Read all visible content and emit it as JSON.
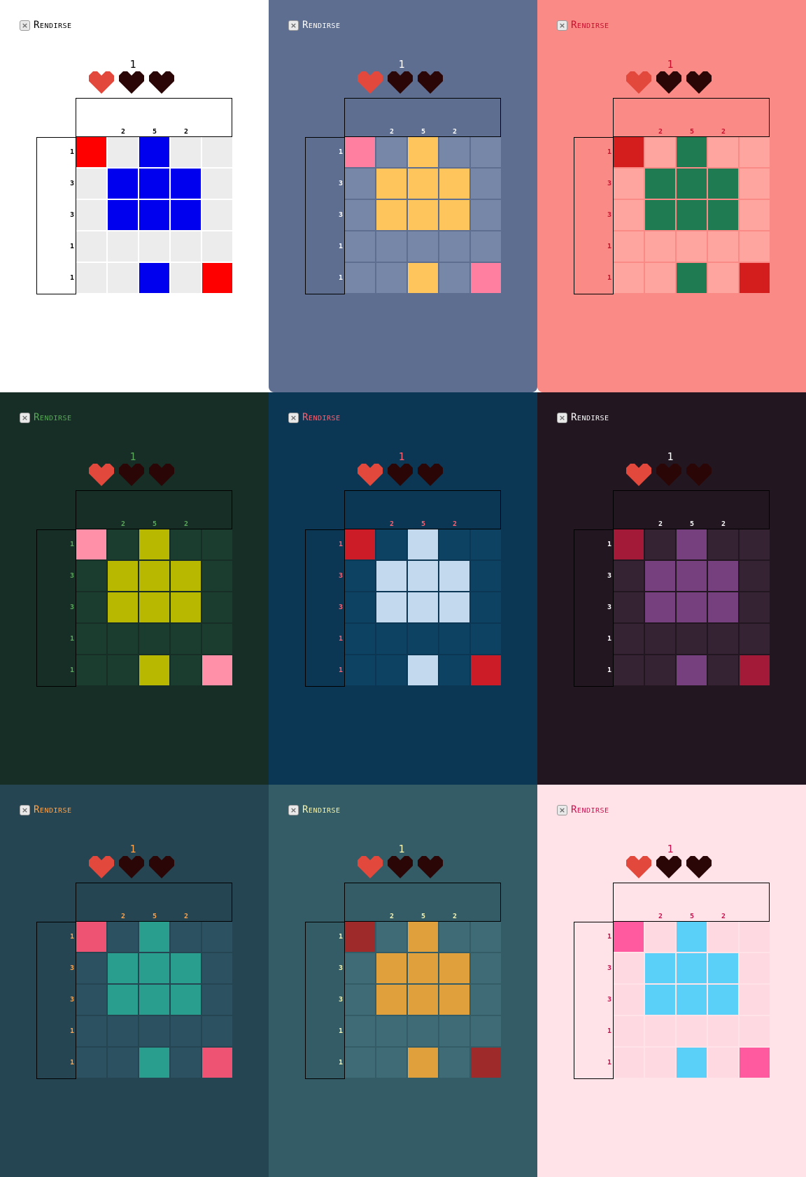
{
  "puzzle": {
    "lives_remaining": "1",
    "hearts": [
      "filled",
      "empty",
      "empty"
    ],
    "surrender_label": "Rendirse",
    "column_clues": [
      "",
      "2",
      "5",
      "2",
      ""
    ],
    "row_clues": [
      "1",
      "3",
      "3",
      "1",
      "1"
    ],
    "board": [
      [
        "x",
        "-",
        "#",
        "-",
        "-"
      ],
      [
        "-",
        "#",
        "#",
        "#",
        "-"
      ],
      [
        "-",
        "#",
        "#",
        "#",
        "-"
      ],
      [
        "-",
        "-",
        "-",
        "-",
        "-"
      ],
      [
        "-",
        "-",
        "#",
        "-",
        "x"
      ]
    ]
  },
  "themes": [
    {
      "bg": "#ffffff",
      "text": "#000000",
      "empty": "#ececec",
      "filled": "#0000ee",
      "crossed": "#ff0000",
      "heart": "#e2493c",
      "heart_empty": "#2b0606"
    },
    {
      "bg": "#5e6e91",
      "text": "#ffffff",
      "empty": "#7787a8",
      "filled": "#fdc55b",
      "crossed": "#ff7fa0",
      "heart": "#e2493c",
      "heart_empty": "#2b0606"
    },
    {
      "bg": "#f98a86",
      "text": "#c8102e",
      "empty": "#ffa5a0",
      "filled": "#1e7b52",
      "crossed": "#d41e1e",
      "heart": "#e2493c",
      "heart_empty": "#2b0606"
    },
    {
      "bg": "#162e25",
      "text": "#5aa95a",
      "empty": "#1b3d30",
      "filled": "#b8b800",
      "crossed": "#ff90a8",
      "heart": "#e2493c",
      "heart_empty": "#2b0606"
    },
    {
      "bg": "#0b3754",
      "text": "#ff6070",
      "empty": "#0e4263",
      "filled": "#c3d9ee",
      "crossed": "#cc1c28",
      "heart": "#e2493c",
      "heart_empty": "#2b0606"
    },
    {
      "bg": "#221621",
      "text": "#ffffff",
      "empty": "#352232",
      "filled": "#76407e",
      "crossed": "#a21a38",
      "heart": "#e2493c",
      "heart_empty": "#2b0606"
    },
    {
      "bg": "#264552",
      "text": "#ffa34a",
      "empty": "#2c5161",
      "filled": "#2a9e8e",
      "crossed": "#ef5374",
      "heart": "#e2493c",
      "heart_empty": "#2b0606"
    },
    {
      "bg": "#345c66",
      "text": "#f5f5b0",
      "empty": "#3f6b77",
      "filled": "#e0a03c",
      "crossed": "#9e2a2a",
      "heart": "#e2493c",
      "heart_empty": "#2b0606"
    },
    {
      "bg": "#ffe3e9",
      "text": "#c8104e",
      "empty": "#ffd9e1",
      "filled": "#5ad0f8",
      "crossed": "#ff5aa0",
      "heart": "#e2493c",
      "heart_empty": "#2b0606"
    }
  ]
}
